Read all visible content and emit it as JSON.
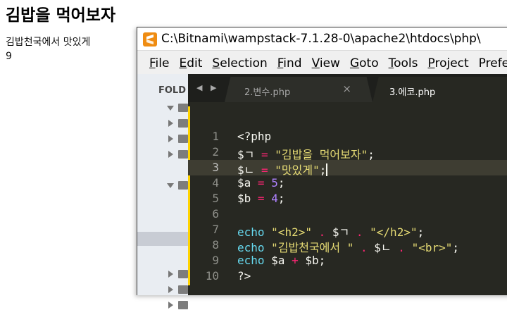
{
  "browser": {
    "heading": "김밥을 먹어보자",
    "line1": "김밥천국에서 맛있게",
    "line2": "9"
  },
  "window": {
    "title": "C:\\Bitnami\\wampstack-7.1.28-0\\apache2\\htdocs\\php\\"
  },
  "menu": [
    {
      "accel": "F",
      "rest": "ile"
    },
    {
      "accel": "E",
      "rest": "dit"
    },
    {
      "accel": "S",
      "rest": "election"
    },
    {
      "accel": "F",
      "rest": "ind"
    },
    {
      "accel": "V",
      "rest": "iew"
    },
    {
      "accel": "G",
      "rest": "oto"
    },
    {
      "accel": "T",
      "rest": "ools"
    },
    {
      "accel": "P",
      "rest": "roject"
    },
    {
      "accel": "",
      "rest": "Prefe"
    }
  ],
  "sidebar": {
    "folders_label": "FOLD"
  },
  "tabs": [
    {
      "label": "2.변수.php",
      "close": "×",
      "active": false
    },
    {
      "label": "3.에코.php",
      "close": "×",
      "active": true
    }
  ],
  "nav": {
    "arrows": "◀ ▶"
  },
  "code": {
    "numbers": [
      "1",
      "2",
      "3",
      "4",
      "5",
      "6",
      "7",
      "8",
      "9",
      "10"
    ],
    "current_line": 3
  },
  "colors": {
    "editor_bg": "#272822",
    "keyword": "#f92672",
    "string": "#e6db74",
    "number": "#ae81ff",
    "function": "#66d9ef",
    "modified_bar": "#ffd400",
    "app_icon": "#ef8c12"
  }
}
